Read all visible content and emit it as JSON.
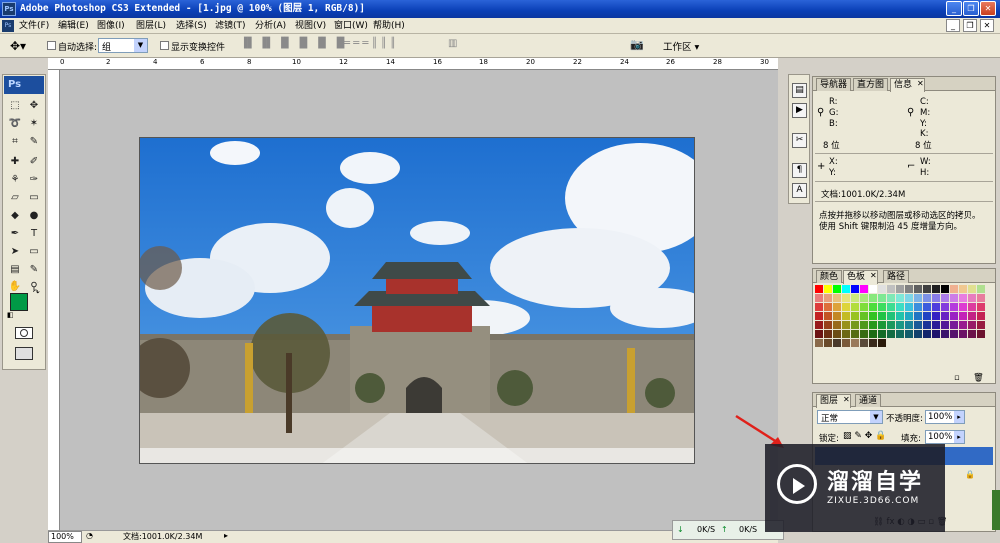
{
  "title": "Adobe Photoshop CS3 Extended - [1.jpg @ 100% (图层 1, RGB/8)]",
  "app_icon": "Ps",
  "menu": [
    "文件(F)",
    "编辑(E)",
    "图像(I)",
    "图层(L)",
    "选择(S)",
    "滤镜(T)",
    "分析(A)",
    "视图(V)",
    "窗口(W)",
    "帮助(H)"
  ],
  "options": {
    "auto_select_label": "自动选择:",
    "auto_select_value": "组",
    "show_transform_label": "显示变换控件",
    "workspace_label": "工作区 ▾"
  },
  "ruler_ticks": [
    "0",
    "2",
    "4",
    "6",
    "8",
    "10",
    "12",
    "14",
    "16",
    "18",
    "20",
    "22",
    "24",
    "26",
    "28",
    "30"
  ],
  "status": {
    "zoom": "100%",
    "doc": "文档:1001.0K/2.34M",
    "net_left": "0K/S",
    "net_right": "0K/S"
  },
  "info_panel": {
    "tabs": [
      "导航器",
      "直方图",
      "信息"
    ],
    "active_tab": "信息",
    "left": {
      "r": "R:",
      "g": "G:",
      "b": "B:",
      "bits": "8 位"
    },
    "right": {
      "c": "C:",
      "m": "M:",
      "y": "Y:",
      "k": "K:",
      "bits": "8 位"
    },
    "xy": {
      "x": "X:",
      "y": "Y:"
    },
    "wh": {
      "w": "W:",
      "h": "H:"
    },
    "doc": "文档:1001.0K/2.34M",
    "hint1": "点按并拖移以移动图层或移动选区的拷贝。",
    "hint2": "使用 Shift 键限制沿 45 度增量方向。"
  },
  "swatch_panel": {
    "tabs": [
      "颜色",
      "色板",
      "路径"
    ],
    "active_tab": "色板"
  },
  "layers_panel": {
    "tabs": [
      "图层",
      "通道"
    ],
    "active_tab": "图层",
    "blend": "正常",
    "opacity_label": "不透明度:",
    "opacity_value": "100%",
    "lock_label": "锁定:",
    "fill_label": "填充:",
    "fill_value": "100%"
  },
  "colors": {
    "foreground": "#009a46",
    "background": "#ffffff",
    "accent": "#2a63d8"
  },
  "watermark": {
    "title": "溜溜自学",
    "url": "ZIXUE.3D66.COM"
  }
}
